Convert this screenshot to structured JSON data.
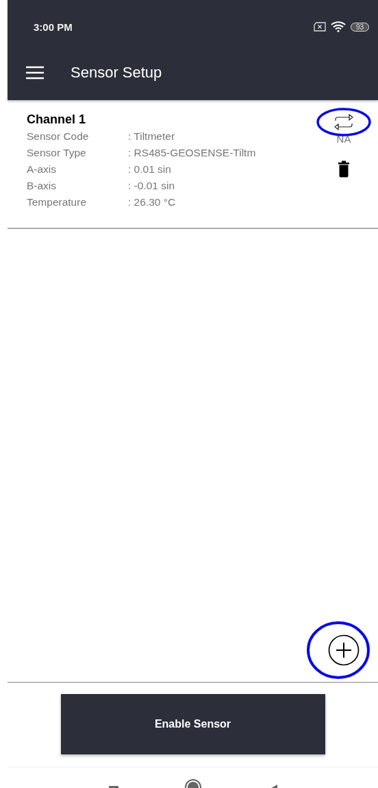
{
  "status_bar": {
    "time": "3:00 PM",
    "battery": "93"
  },
  "app_bar": {
    "title": "Sensor Setup"
  },
  "channels": [
    {
      "title": "Channel 1",
      "status": "NA",
      "swap_highlighted": true,
      "fields": [
        {
          "label": "Sensor Code",
          "value": ": Tiltmeter"
        },
        {
          "label": "Sensor Type",
          "value": ": RS485-GEOSENSE-Tiltm"
        },
        {
          "label": "A-axis",
          "value": ": 0.01 sin"
        },
        {
          "label": "B-axis",
          "value": ": -0.01 sin"
        },
        {
          "label": "Temperature",
          "value": ": 26.30 °C"
        }
      ]
    }
  ],
  "add_button": {
    "highlighted": true
  },
  "enable_button": {
    "label": "Enable Sensor"
  }
}
